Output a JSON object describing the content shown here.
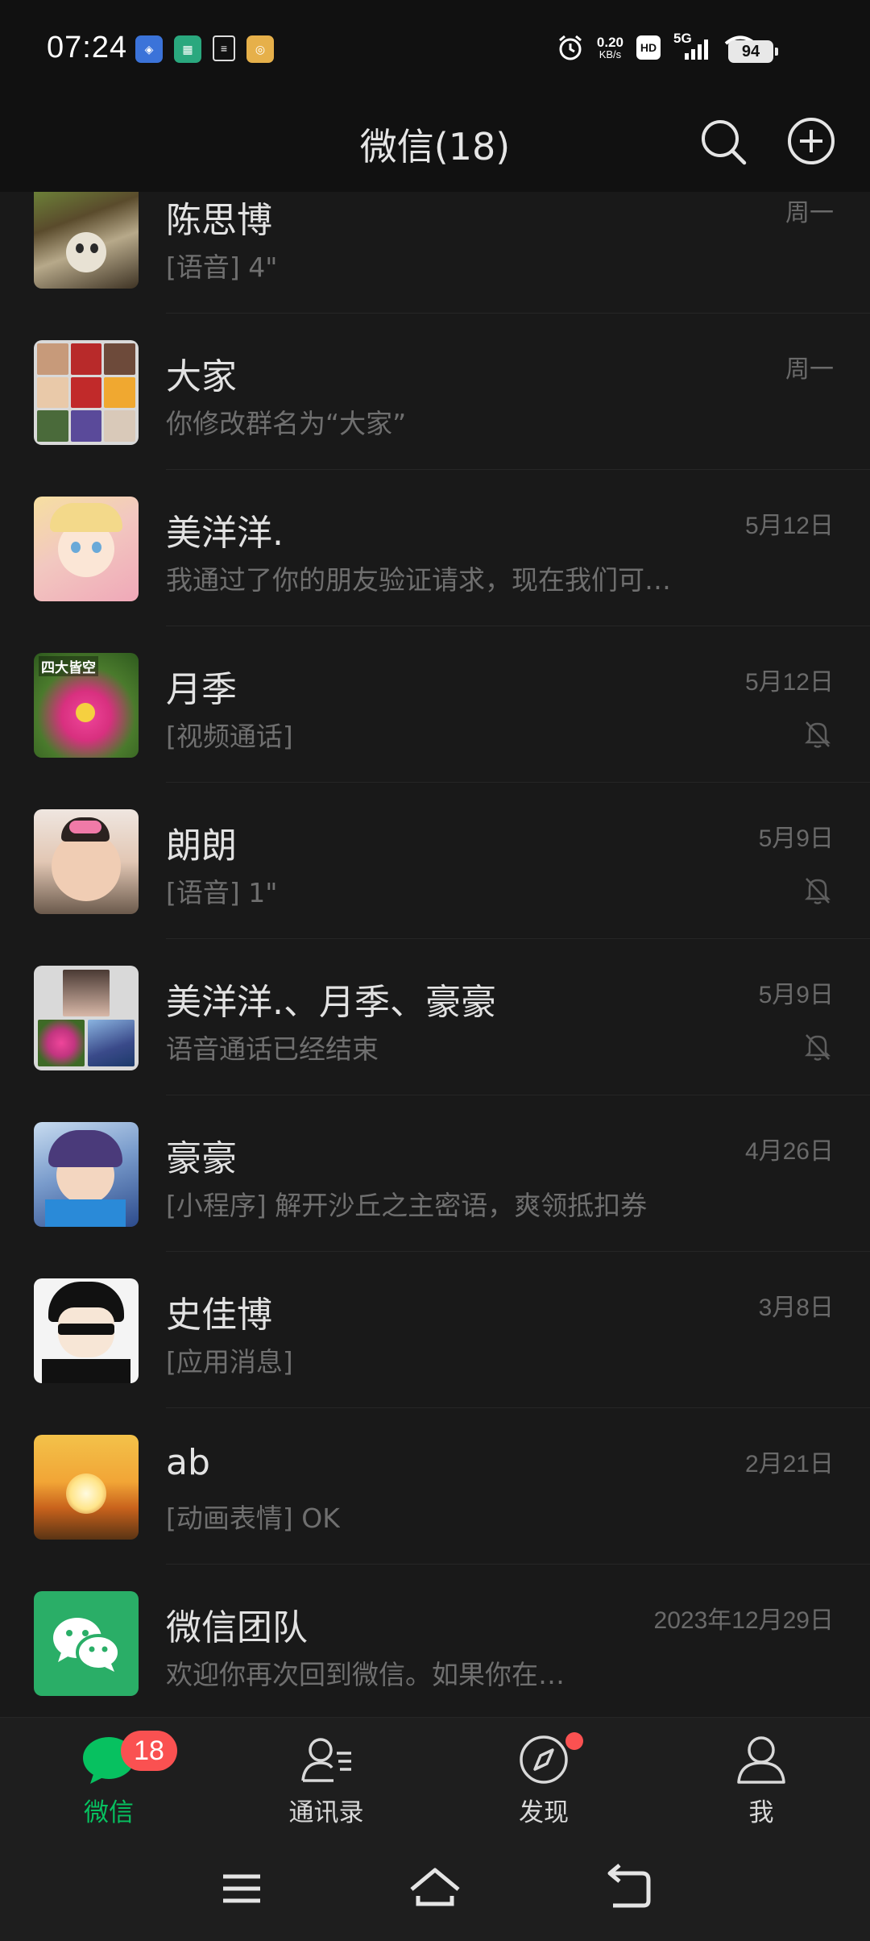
{
  "status_bar": {
    "time": "07:24",
    "net_speed_value": "0.20",
    "net_speed_unit": "KB/s",
    "hd_label": "HD",
    "network": "5G",
    "battery": "94"
  },
  "header": {
    "title": "微信(18)",
    "search_icon": "search-icon",
    "add_icon": "plus-circle-icon"
  },
  "chats": [
    {
      "name": "陈思博",
      "preview": "[语音] 4\"",
      "time": "周一",
      "muted": false
    },
    {
      "name": "大家",
      "preview": "你修改群名为“大家”",
      "time": "周一",
      "muted": false
    },
    {
      "name": "美洋洋.",
      "preview": "我通过了你的朋友验证请求，现在我们可…",
      "time": "5月12日",
      "muted": false
    },
    {
      "name": "月季",
      "preview": "[视频通话]",
      "time": "5月12日",
      "muted": true,
      "avatar_text": "四大皆空"
    },
    {
      "name": "朗朗",
      "preview": "[语音] 1\"",
      "time": "5月9日",
      "muted": true
    },
    {
      "name": "美洋洋.、月季、豪豪",
      "preview": "语音通话已经结束",
      "time": "5月9日",
      "muted": true
    },
    {
      "name": "豪豪",
      "preview": "[小程序] 解开沙丘之主密语，爽领抵扣券",
      "time": "4月26日",
      "muted": false
    },
    {
      "name": "史佳博",
      "preview": "[应用消息]",
      "time": "3月8日",
      "muted": false
    },
    {
      "name": "ab",
      "preview": "[动画表情] OK",
      "time": "2月21日",
      "muted": false
    },
    {
      "name": "微信团队",
      "preview": "欢迎你再次回到微信。如果你在…",
      "time": "2023年12月29日",
      "muted": false
    }
  ],
  "tabs": [
    {
      "label": "微信",
      "icon": "chat-bubble-icon",
      "badge": "18",
      "active": true
    },
    {
      "label": "通讯录",
      "icon": "contacts-icon"
    },
    {
      "label": "发现",
      "icon": "compass-icon",
      "dot": true
    },
    {
      "label": "我",
      "icon": "person-icon"
    }
  ],
  "colors": {
    "background": "#191919",
    "accent": "#07c160",
    "badge": "#fa5151"
  }
}
